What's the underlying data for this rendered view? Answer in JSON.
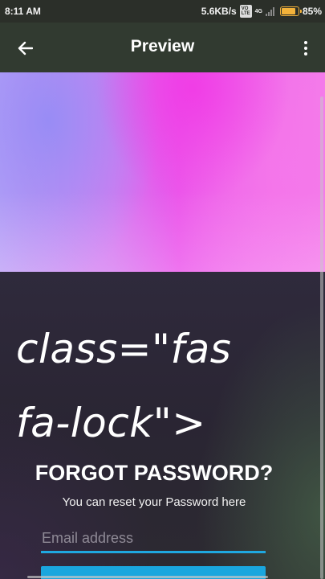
{
  "status_bar": {
    "time": "8:11 AM",
    "speed": "5.6KB/s",
    "volte": "Vo LTE",
    "network": "4G",
    "battery_percent": "85%",
    "battery_level": 0.85
  },
  "app_bar": {
    "title": "Preview",
    "back_icon": "arrow-left-icon",
    "more_icon": "more-vertical-icon"
  },
  "preview": {
    "code_text": "class=\"fas\nfa-lock\">",
    "forgot_title": "FORGOT PASSWORD?",
    "forgot_subtitle": "You can reset your Password here",
    "email_placeholder": "Email address"
  },
  "colors": {
    "accent": "#1aa6de",
    "app_bar": "#313a30",
    "status_bar": "#2b2f29",
    "battery": "#f3b23a"
  }
}
